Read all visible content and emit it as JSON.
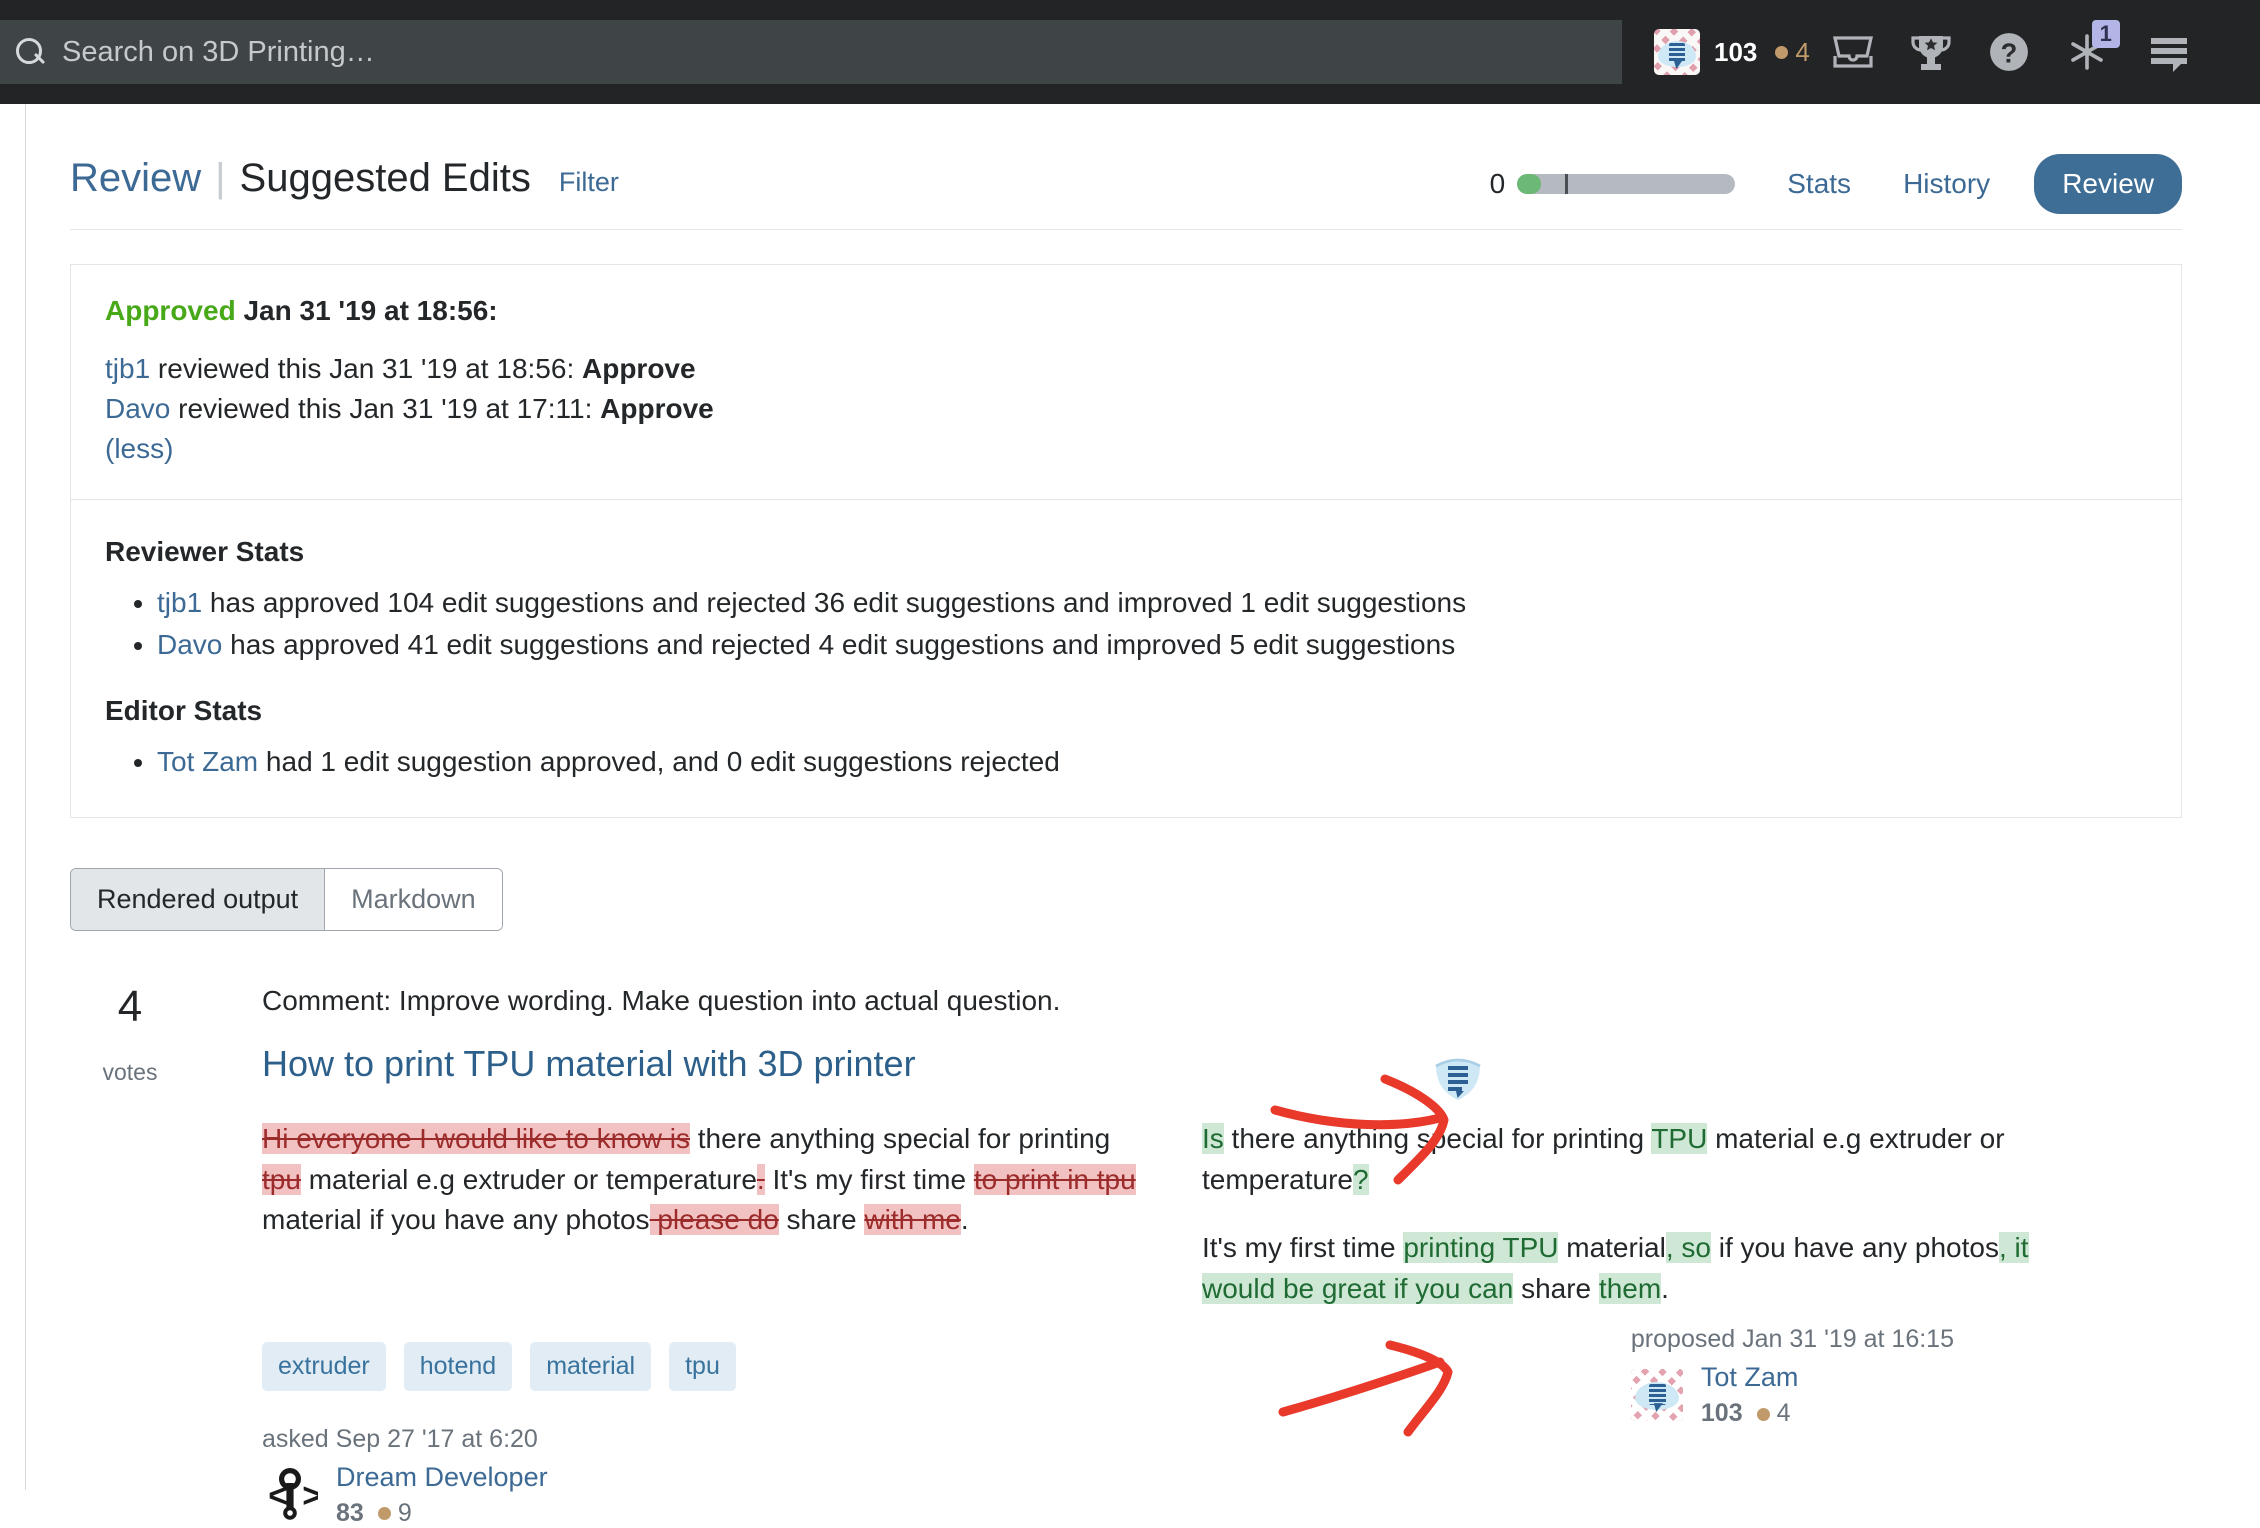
{
  "topbar": {
    "search_placeholder": "Search on 3D Printing…",
    "search_value": "",
    "reputation": "103",
    "badge_count": "4",
    "icons": [
      "inbox-icon",
      "trophy-icon",
      "help-icon",
      "site-switcher-icon",
      "hamburger-icon"
    ],
    "site_switcher_badge": "1"
  },
  "header": {
    "review_link": "Review",
    "separator": "|",
    "title": "Suggested Edits",
    "filter": "Filter",
    "progress_value": "0",
    "stats": "Stats",
    "history": "History",
    "review_button": "Review"
  },
  "card": {
    "approved_label": "Approved",
    "approved_date": "Jan 31 '19 at 18:56:",
    "reviews": [
      {
        "user": "tjb1",
        "text": " reviewed this Jan 31 '19 at 18:56: ",
        "action": "Approve"
      },
      {
        "user": "Davo",
        "text": " reviewed this Jan 31 '19 at 17:11: ",
        "action": "Approve"
      }
    ],
    "less_link": "(less)",
    "reviewer_stats_heading": "Reviewer Stats",
    "reviewer_stats": [
      {
        "user": "tjb1",
        "text": " has approved 104 edit suggestions and rejected 36 edit suggestions and improved 1 edit suggestions"
      },
      {
        "user": "Davo",
        "text": " has approved 41 edit suggestions and rejected 4 edit suggestions and improved 5 edit suggestions"
      }
    ],
    "editor_stats_heading": "Editor Stats",
    "editor_stats": [
      {
        "user": "Tot Zam",
        "text": " had 1 edit suggestion approved, and 0 edit suggestions rejected"
      }
    ]
  },
  "toggle": {
    "rendered": "Rendered output",
    "markdown": "Markdown"
  },
  "post": {
    "votes": "4",
    "votes_label": "votes",
    "comment": "Comment: Improve wording. Make question into actual question.",
    "title": "How to print TPU material with 3D printer",
    "left_diff": {
      "p1": [
        {
          "t": "Hi everyone I would like to know is",
          "k": "del"
        },
        {
          "t": " there anything special for printing ",
          "k": "eq"
        },
        {
          "t": "tpu",
          "k": "del"
        },
        {
          "t": " material e.g extruder or temperature",
          "k": "eq"
        },
        {
          "t": ".",
          "k": "del"
        },
        {
          "t": " It's my first time ",
          "k": "eq"
        },
        {
          "t": "to print in tpu",
          "k": "del"
        },
        {
          "t": " material if you have any photos",
          "k": "eq"
        },
        {
          "t": " please do",
          "k": "del"
        },
        {
          "t": " share ",
          "k": "eq"
        },
        {
          "t": "with me",
          "k": "del"
        },
        {
          "t": ".",
          "k": "eq"
        }
      ]
    },
    "right_diff": {
      "p1": [
        {
          "t": "Is",
          "k": "ins"
        },
        {
          "t": " there anything special for printing ",
          "k": "eq"
        },
        {
          "t": "TPU",
          "k": "ins"
        },
        {
          "t": " material e.g extruder or temperature",
          "k": "eq"
        },
        {
          "t": "?",
          "k": "ins"
        }
      ],
      "p2": [
        {
          "t": "It's my first time ",
          "k": "eq"
        },
        {
          "t": "printing TPU",
          "k": "ins"
        },
        {
          "t": " material",
          "k": "eq"
        },
        {
          "t": ", so",
          "k": "ins"
        },
        {
          "t": " if you have any photos",
          "k": "eq"
        },
        {
          "t": ", it would be great if you can",
          "k": "ins"
        },
        {
          "t": " share ",
          "k": "eq"
        },
        {
          "t": "them",
          "k": "ins"
        },
        {
          "t": ".",
          "k": "eq"
        }
      ]
    },
    "tags": [
      "extruder",
      "hotend",
      "material",
      "tpu"
    ],
    "asked": "asked Sep 27 '17 at 6:20",
    "asker": {
      "name": "Dream Developer",
      "rep": "83",
      "badges": "9",
      "avatar": "code-wrench-avatar"
    },
    "proposed": "proposed Jan 31 '19 at 16:15",
    "proposer": {
      "name": "Tot Zam",
      "rep": "103",
      "badges": "4",
      "avatar": "mask-logo-avatar"
    }
  },
  "annotations": {
    "arrow1": "red-arrow-pointing-right-to-shield-icon",
    "arrow2": "red-arrow-pointing-right-to-proposer-avatar"
  },
  "colors": {
    "topbar_bg": "#222426",
    "accent_blue": "#3d6a95",
    "approved_green": "#48a918",
    "deletion_bg": "#f2c2c2",
    "insertion_bg": "#cfe8d5",
    "annotation_red": "#e8392b"
  }
}
